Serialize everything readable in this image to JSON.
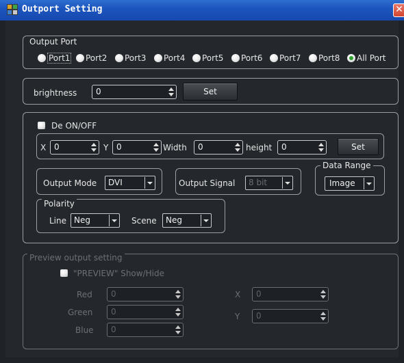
{
  "window": {
    "title": "Outport Setting",
    "close": "✕"
  },
  "output_port": {
    "legend": "Output Port",
    "ports": [
      "Port1",
      "Port2",
      "Port3",
      "Port4",
      "Port5",
      "Port6",
      "Port7",
      "Port8",
      "All Port"
    ],
    "selected": "All Port"
  },
  "brightness": {
    "label": "brightness",
    "value": "0",
    "set_label": "Set"
  },
  "geometry": {
    "de_label": "De ON/OFF",
    "x_label": "X",
    "x_value": "0",
    "y_label": "Y",
    "y_value": "0",
    "width_label": "Width",
    "width_value": "0",
    "height_label": "height",
    "height_value": "0",
    "set_label": "Set",
    "output_mode_label": "Output Mode",
    "output_mode_value": "DVI",
    "output_signal_label": "Output Signal",
    "output_signal_value": "8 bit",
    "data_range_legend": "Data Range",
    "data_range_value": "Image",
    "polarity_legend": "Polarity",
    "line_label": "Line",
    "line_value": "Neg",
    "scene_label": "Scene",
    "scene_value": "Neg"
  },
  "preview": {
    "legend": "Preview output setting",
    "show_hide_label": "\"PREVIEW\" Show/Hide",
    "red_label": "Red",
    "red_value": "0",
    "green_label": "Green",
    "green_value": "0",
    "blue_label": "Blue",
    "blue_value": "0",
    "x_label": "X",
    "x_value": "0",
    "y_label": "Y",
    "y_value": "0"
  },
  "colors": {
    "titlebar": "#1d55be",
    "background": "#24282c",
    "close": "#d2452f",
    "radio_selected": "#2fa32f"
  }
}
